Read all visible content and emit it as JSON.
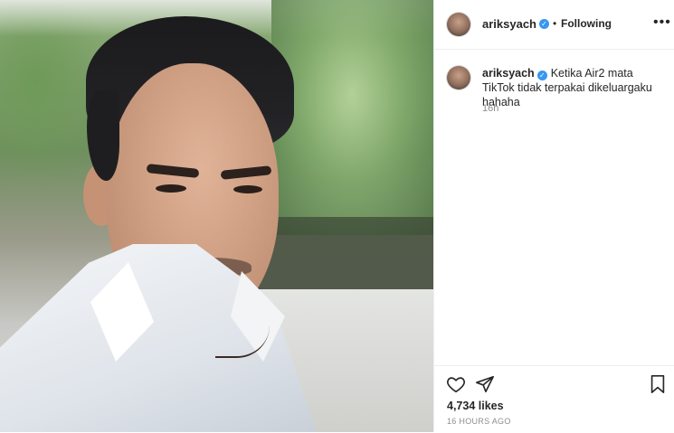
{
  "post": {
    "username": "ariksyach",
    "following_label": "Following",
    "separator": "•",
    "more_icon": "more-horizontal-icon",
    "caption_text": "Ketika Air2 mata TikTok tidak terpakai dikeluargaku hahaha",
    "caption_time": "16h",
    "likes": "4,734 likes",
    "posted_ago": "16 HOURS AGO"
  },
  "icons": {
    "like": "heart-icon",
    "share": "send-icon",
    "save": "bookmark-icon",
    "verified": "verified-badge-icon"
  },
  "colors": {
    "verified": "#3897f0",
    "text": "#262626",
    "muted": "#8e8e8e",
    "divider": "#efefef"
  }
}
